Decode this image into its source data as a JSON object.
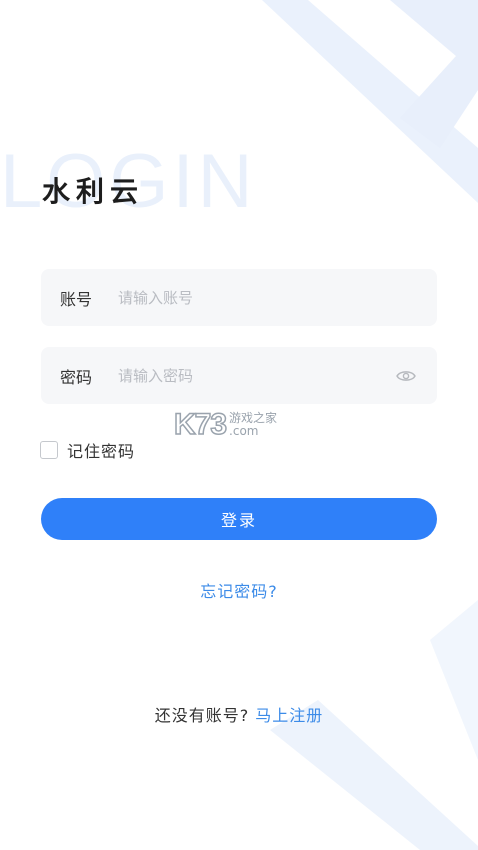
{
  "watermark": "LOGIN",
  "app_title": "水利云",
  "username": {
    "label": "账号",
    "placeholder": "请输入账号",
    "value": ""
  },
  "password": {
    "label": "密码",
    "placeholder": "请输入密码",
    "value": ""
  },
  "remember": {
    "label": "记住密码",
    "checked": false
  },
  "login_button": "登录",
  "forgot_link": "忘记密码?",
  "register": {
    "question": "还没有账号?",
    "link": "马上注册"
  },
  "site_mark": {
    "logo": "K73",
    "name": "游戏之家",
    "domain": ".com"
  },
  "colors": {
    "primary": "#2f80f9",
    "link": "#3c8be8",
    "field_bg": "#f6f7f9",
    "decor": "#e6eefb"
  }
}
